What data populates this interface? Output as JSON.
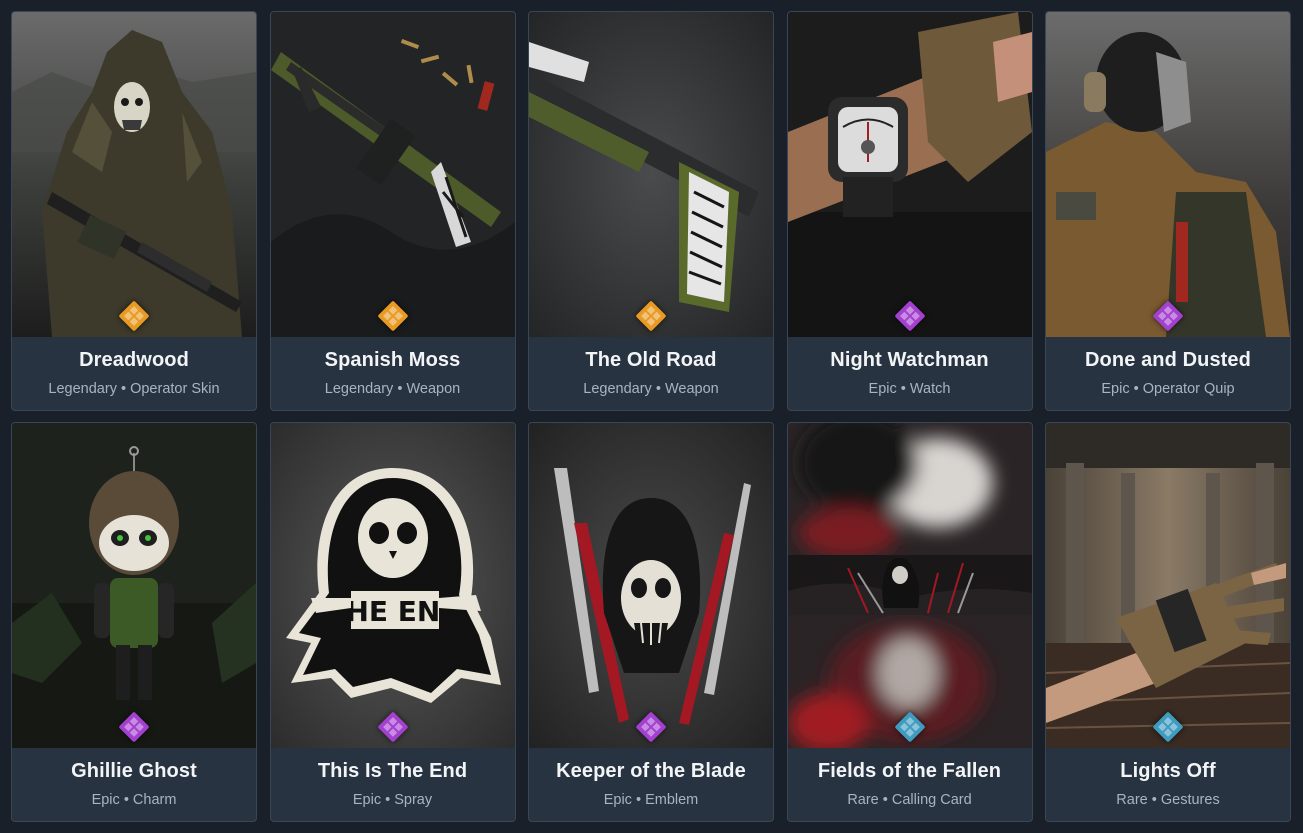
{
  "colors": {
    "legendary": "#f0a028",
    "epic": "#b04ad8",
    "rare": "#4aa8c8",
    "card_bg": "#283341",
    "page_bg": "#1a2029"
  },
  "separator": "•",
  "items": [
    {
      "name": "Dreadwood",
      "rarity": "Legendary",
      "type": "Operator Skin",
      "icon": "legendary-rarity-icon"
    },
    {
      "name": "Spanish Moss",
      "rarity": "Legendary",
      "type": "Weapon",
      "icon": "legendary-rarity-icon"
    },
    {
      "name": "The Old Road",
      "rarity": "Legendary",
      "type": "Weapon",
      "icon": "legendary-rarity-icon"
    },
    {
      "name": "Night Watchman",
      "rarity": "Epic",
      "type": "Watch",
      "icon": "epic-rarity-icon"
    },
    {
      "name": "Done and Dusted",
      "rarity": "Epic",
      "type": "Operator Quip",
      "icon": "epic-rarity-icon"
    },
    {
      "name": "Ghillie Ghost",
      "rarity": "Epic",
      "type": "Charm",
      "icon": "epic-rarity-icon"
    },
    {
      "name": "This Is The End",
      "rarity": "Epic",
      "type": "Spray",
      "icon": "epic-rarity-icon",
      "art_text": "THE END"
    },
    {
      "name": "Keeper of the Blade",
      "rarity": "Epic",
      "type": "Emblem",
      "icon": "epic-rarity-icon"
    },
    {
      "name": "Fields of the Fallen",
      "rarity": "Rare",
      "type": "Calling Card",
      "icon": "rare-rarity-icon"
    },
    {
      "name": "Lights Off",
      "rarity": "Rare",
      "type": "Gestures",
      "icon": "rare-rarity-icon"
    }
  ]
}
